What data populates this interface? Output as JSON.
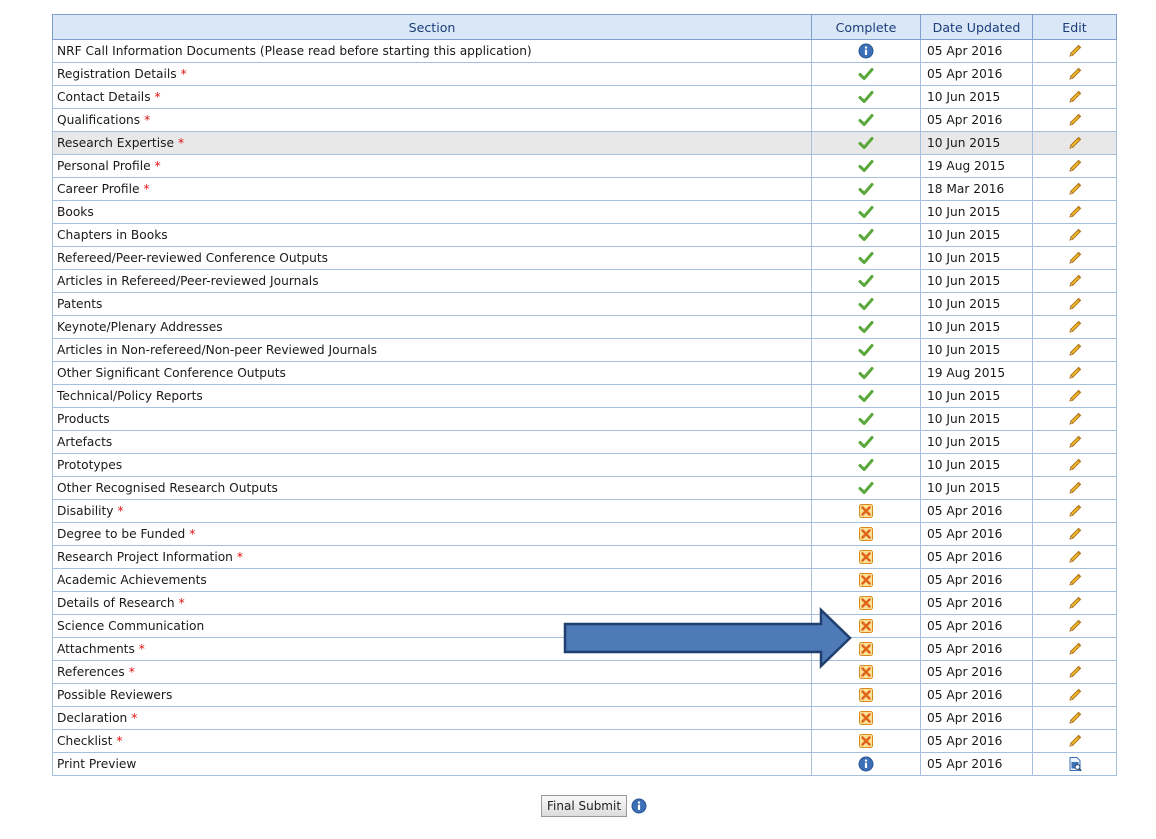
{
  "table": {
    "headers": {
      "section": "Section",
      "complete": "Complete",
      "date": "Date Updated",
      "edit": "Edit"
    },
    "required_marker": "*",
    "rows": [
      {
        "section": "NRF Call Information Documents (Please read before starting this application)",
        "required": false,
        "status": "info",
        "date": "05 Apr 2016",
        "edit_icon": "pencil"
      },
      {
        "section": "Registration Details",
        "required": true,
        "status": "complete",
        "date": "05 Apr 2016",
        "edit_icon": "pencil"
      },
      {
        "section": "Contact Details",
        "required": true,
        "status": "complete",
        "date": "10 Jun 2015",
        "edit_icon": "pencil"
      },
      {
        "section": "Qualifications",
        "required": true,
        "status": "complete",
        "date": "05 Apr 2016",
        "edit_icon": "pencil"
      },
      {
        "section": "Research Expertise",
        "required": true,
        "status": "complete",
        "date": "10 Jun 2015",
        "edit_icon": "pencil",
        "highlighted": true
      },
      {
        "section": "Personal Profile",
        "required": true,
        "status": "complete",
        "date": "19 Aug 2015",
        "edit_icon": "pencil"
      },
      {
        "section": "Career Profile",
        "required": true,
        "status": "complete",
        "date": "18 Mar 2016",
        "edit_icon": "pencil"
      },
      {
        "section": "Books",
        "required": false,
        "status": "complete",
        "date": "10 Jun 2015",
        "edit_icon": "pencil"
      },
      {
        "section": "Chapters in Books",
        "required": false,
        "status": "complete",
        "date": "10 Jun 2015",
        "edit_icon": "pencil"
      },
      {
        "section": "Refereed/Peer-reviewed Conference Outputs",
        "required": false,
        "status": "complete",
        "date": "10 Jun 2015",
        "edit_icon": "pencil"
      },
      {
        "section": "Articles in Refereed/Peer-reviewed Journals",
        "required": false,
        "status": "complete",
        "date": "10 Jun 2015",
        "edit_icon": "pencil"
      },
      {
        "section": "Patents",
        "required": false,
        "status": "complete",
        "date": "10 Jun 2015",
        "edit_icon": "pencil"
      },
      {
        "section": "Keynote/Plenary Addresses",
        "required": false,
        "status": "complete",
        "date": "10 Jun 2015",
        "edit_icon": "pencil"
      },
      {
        "section": "Articles in Non-refereed/Non-peer Reviewed Journals",
        "required": false,
        "status": "complete",
        "date": "10 Jun 2015",
        "edit_icon": "pencil"
      },
      {
        "section": "Other Significant Conference Outputs",
        "required": false,
        "status": "complete",
        "date": "19 Aug 2015",
        "edit_icon": "pencil"
      },
      {
        "section": "Technical/Policy Reports",
        "required": false,
        "status": "complete",
        "date": "10 Jun 2015",
        "edit_icon": "pencil"
      },
      {
        "section": "Products",
        "required": false,
        "status": "complete",
        "date": "10 Jun 2015",
        "edit_icon": "pencil"
      },
      {
        "section": "Artefacts",
        "required": false,
        "status": "complete",
        "date": "10 Jun 2015",
        "edit_icon": "pencil"
      },
      {
        "section": "Prototypes",
        "required": false,
        "status": "complete",
        "date": "10 Jun 2015",
        "edit_icon": "pencil"
      },
      {
        "section": "Other Recognised Research Outputs",
        "required": false,
        "status": "complete",
        "date": "10 Jun 2015",
        "edit_icon": "pencil"
      },
      {
        "section": "Disability",
        "required": true,
        "status": "incomplete",
        "date": "05 Apr 2016",
        "edit_icon": "pencil"
      },
      {
        "section": "Degree to be Funded",
        "required": true,
        "status": "incomplete",
        "date": "05 Apr 2016",
        "edit_icon": "pencil"
      },
      {
        "section": "Research Project Information",
        "required": true,
        "status": "incomplete",
        "date": "05 Apr 2016",
        "edit_icon": "pencil"
      },
      {
        "section": "Academic Achievements",
        "required": false,
        "status": "incomplete",
        "date": "05 Apr 2016",
        "edit_icon": "pencil"
      },
      {
        "section": "Details of Research",
        "required": true,
        "status": "incomplete",
        "date": "05 Apr 2016",
        "edit_icon": "pencil"
      },
      {
        "section": "Science Communication",
        "required": false,
        "status": "incomplete",
        "date": "05 Apr 2016",
        "edit_icon": "pencil"
      },
      {
        "section": "Attachments",
        "required": true,
        "status": "incomplete",
        "date": "05 Apr 2016",
        "edit_icon": "pencil"
      },
      {
        "section": "References",
        "required": true,
        "status": "incomplete",
        "date": "05 Apr 2016",
        "edit_icon": "pencil"
      },
      {
        "section": "Possible Reviewers",
        "required": false,
        "status": "incomplete",
        "date": "05 Apr 2016",
        "edit_icon": "pencil"
      },
      {
        "section": "Declaration",
        "required": true,
        "status": "incomplete",
        "date": "05 Apr 2016",
        "edit_icon": "pencil"
      },
      {
        "section": "Checklist",
        "required": true,
        "status": "incomplete",
        "date": "05 Apr 2016",
        "edit_icon": "pencil"
      },
      {
        "section": "Print Preview",
        "required": false,
        "status": "info",
        "date": "05 Apr 2016",
        "edit_icon": "print-preview"
      }
    ]
  },
  "footer": {
    "submit_label": "Final Submit",
    "info_icon": "info-icon"
  },
  "annotation": {
    "type": "arrow-right",
    "color": "#4f7ab8",
    "border": "#1f3f6e"
  },
  "colors": {
    "header_bg": "#d9e7f7",
    "border": "#a6bfdf",
    "required": "#e01010",
    "complete": "#5aa83a",
    "incomplete": "#f0a020",
    "info": "#3d6fb6"
  }
}
